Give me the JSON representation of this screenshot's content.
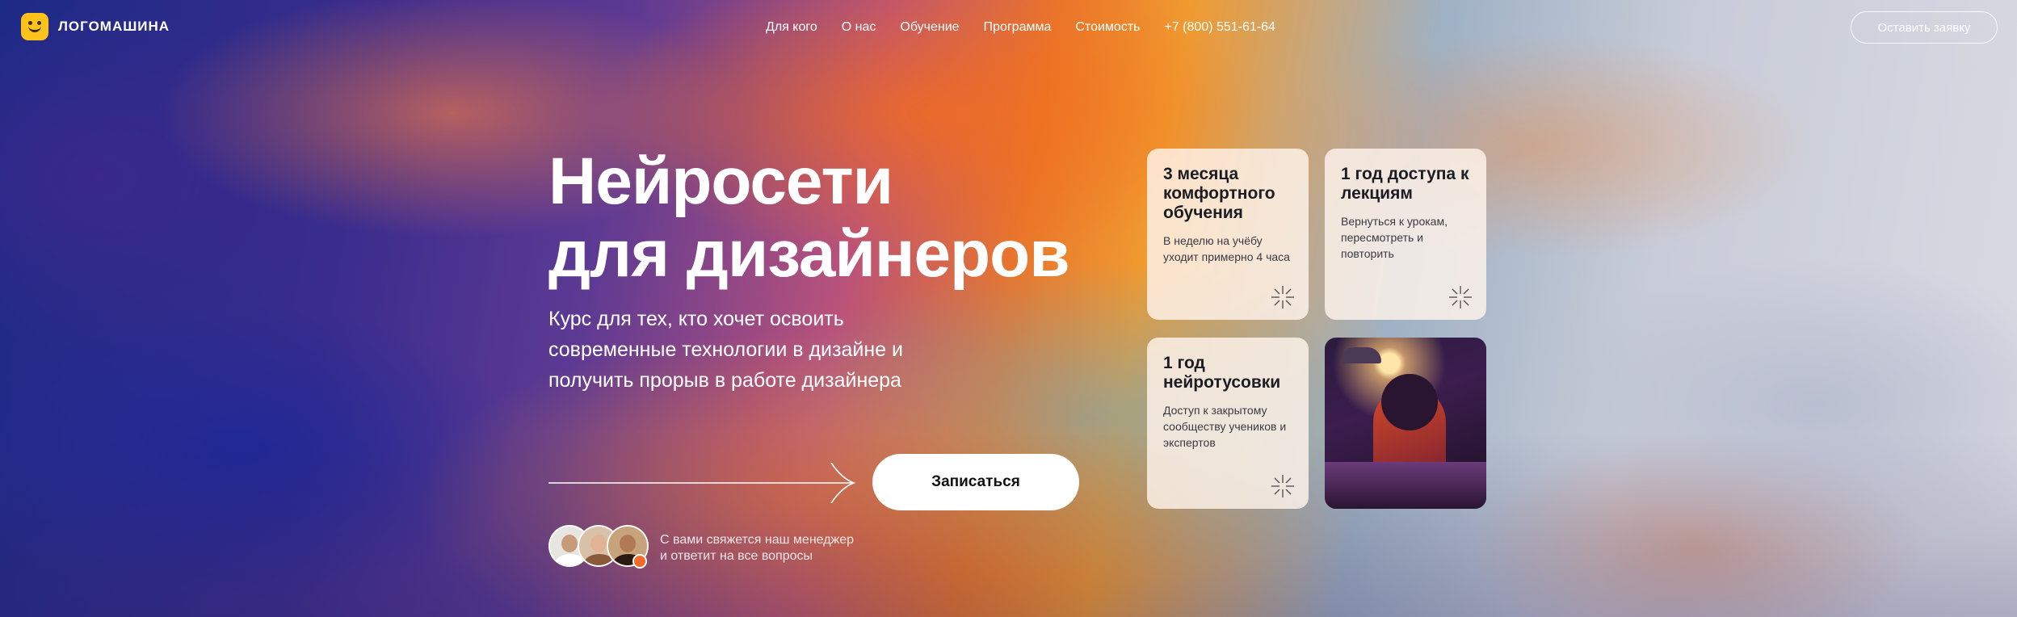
{
  "brand": {
    "name": "ЛОГОМАШИНА",
    "accent": "#ffc21a"
  },
  "nav": {
    "items": [
      "Для кого",
      "О нас",
      "Обучение",
      "Программа",
      "Стоимость"
    ],
    "phone": "+7 (800) 551-61-64"
  },
  "header_cta": "Оставить заявку",
  "hero": {
    "title_line1": "Нейросети",
    "title_line2": "для дизайнеров",
    "subtitle": "Курс для тех, кто хочет освоить современные технологии в дизайне и получить прорыв в работе дизайнера",
    "signup_label": "Записаться",
    "contact_note_line1": "С вами свяжется наш менеджер",
    "contact_note_line2": "и ответит на все вопросы"
  },
  "cards": [
    {
      "title": "3 месяца комфортного обучения",
      "text": "В неделю на учёбу уходит примерно 4 часа",
      "icon": "sparkle-icon"
    },
    {
      "title": "1 год доступа к лекциям",
      "text": "Вернуться к урокам, пересмотреть и повторить",
      "icon": "sparkle-icon"
    },
    {
      "title": "1 год нейротусовки",
      "text": "Доступ к закрытому сообществу учеников и экспертов",
      "icon": "sparkle-icon"
    }
  ],
  "colors": {
    "signup_bg": "#ffffff",
    "card_bg": "#fff4ec",
    "badge": "#f26b2a"
  }
}
